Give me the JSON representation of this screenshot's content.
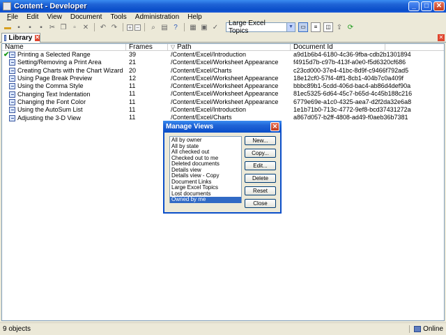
{
  "window": {
    "title": "Content - Developer"
  },
  "menu": [
    "File",
    "Edit",
    "View",
    "Document",
    "Tools",
    "Administration",
    "Help"
  ],
  "menu_accel": [
    "F",
    "E",
    "V",
    "D",
    "T",
    "A",
    "H"
  ],
  "toolbar": {
    "view_select": "Large Excel Topics"
  },
  "tab": {
    "label": "Library"
  },
  "columns": {
    "name": "Name",
    "frames": "Frames",
    "path": "Path",
    "docid": "Document Id"
  },
  "rows": [
    {
      "name": "Printing a Selected Range",
      "frames": "39",
      "path": "/Content/Excel/Introduction",
      "docid": "a9d1b6b4-6180-4c36-9fba-cdb2b1301894",
      "checked": true
    },
    {
      "name": "Setting/Removing a Print Area",
      "frames": "21",
      "path": "/Content/Excel/Worksheet Appearance",
      "docid": "f4915d7b-c97b-413f-a0e0-f5d6320cf686",
      "checked": false
    },
    {
      "name": "Creating Charts with the Chart Wizard",
      "frames": "20",
      "path": "/Content/Excel/Charts",
      "docid": "c23cd000-37e4-41bc-8d9f-c9466f792ad5",
      "checked": false
    },
    {
      "name": "Using Page Break Preview",
      "frames": "12",
      "path": "/Content/Excel/Worksheet Appearance",
      "docid": "18e12cf0-57f4-4ff1-8cb1-404b7c0a409f",
      "checked": false
    },
    {
      "name": "Using the Comma Style",
      "frames": "11",
      "path": "/Content/Excel/Worksheet Appearance",
      "docid": "bbbc89b1-5cdd-406d-bac4-ab86d4def90a",
      "checked": false
    },
    {
      "name": "Changing Text Indentation",
      "frames": "11",
      "path": "/Content/Excel/Worksheet Appearance",
      "docid": "81ec5325-6d64-45c7-b65d-4c45b188c216",
      "checked": false
    },
    {
      "name": "Changing the Font Color",
      "frames": "11",
      "path": "/Content/Excel/Worksheet Appearance",
      "docid": "6779e69e-a1c0-4325-aea7-d2f2da32e6a8",
      "checked": false
    },
    {
      "name": "Using the AutoSum List",
      "frames": "11",
      "path": "/Content/Excel/Introduction",
      "docid": "1e1b71b0-713c-4772-9ef8-bcd37431272a",
      "checked": false
    },
    {
      "name": "Adjusting the 3-D View",
      "frames": "11",
      "path": "/Content/Excel/Charts",
      "docid": "a867d057-b2ff-4808-ad49-f0aeb36b7381",
      "checked": false
    }
  ],
  "status": {
    "count": "9 objects",
    "connection": "Online"
  },
  "dialog": {
    "title": "Manage Views",
    "views": [
      "All by owner",
      "All by state",
      "All checked out",
      "Checked out to me",
      "Deleted documents",
      "Details view",
      "Details view - Copy",
      "Document Links",
      "Large Excel Topics",
      "Lost documents",
      "Owned by me"
    ],
    "selected_index": 10,
    "buttons": {
      "new": "New...",
      "copy": "Copy...",
      "edit": "Edit...",
      "delete": "Delete",
      "reset": "Reset",
      "close": "Close"
    }
  }
}
